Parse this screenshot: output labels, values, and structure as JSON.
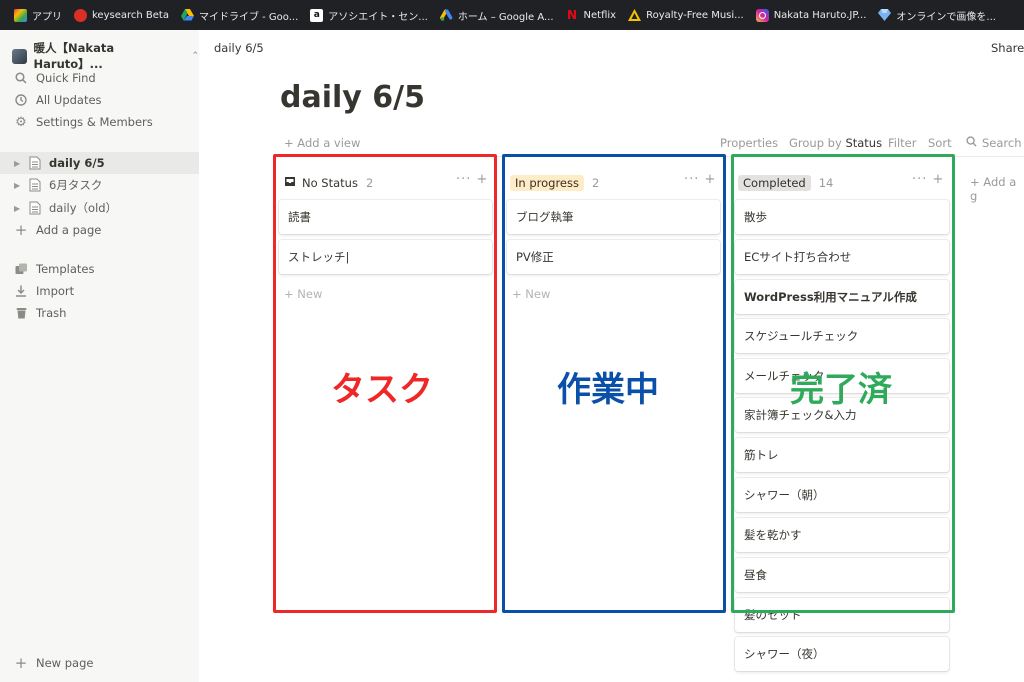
{
  "bookmarks": [
    {
      "label": "アプリ",
      "icon": "apps-grid-icon",
      "color": "#e8453c"
    },
    {
      "label": "keysearch Beta",
      "icon": "keysearch-icon",
      "color": "#d93025"
    },
    {
      "label": "マイドライブ - Goo...",
      "icon": "google-drive-icon",
      "color": "#1fa463"
    },
    {
      "label": "アソシエイト・セン...",
      "icon": "amazon-icon",
      "color": "#ffffff"
    },
    {
      "label": "ホーム – Google A...",
      "icon": "google-ads-icon",
      "color": "#fbbc04"
    },
    {
      "label": "Netflix",
      "icon": "netflix-icon",
      "color": "#e50914"
    },
    {
      "label": "Royalty-Free Musi...",
      "icon": "royalty-free-music-icon",
      "color": "#f5c400"
    },
    {
      "label": "Nakata Haruto.JP...",
      "icon": "instagram-icon",
      "color": "#d6249f"
    },
    {
      "label": "オンラインで画像を...",
      "icon": "gem-icon",
      "color": "#7ab3f0"
    }
  ],
  "sidebar": {
    "workspace": "暖人【Nakata Haruto】...",
    "quick_find": "Quick Find",
    "all_updates": "All Updates",
    "settings": "Settings & Members",
    "pages": [
      {
        "label": "daily 6/5",
        "active": true
      },
      {
        "label": "6月タスク",
        "active": false
      },
      {
        "label": "daily（old）",
        "active": false
      }
    ],
    "add_page": "Add a page",
    "templates": "Templates",
    "import": "Import",
    "trash": "Trash",
    "new_page": "New page"
  },
  "topbar": {
    "breadcrumb": "daily 6/5",
    "share": "Share"
  },
  "page": {
    "title": "daily 6/5"
  },
  "toolbar": {
    "add_view": "+ Add a view",
    "properties": "Properties",
    "group_by": "Group by",
    "group_value": "Status",
    "filter": "Filter",
    "sort": "Sort",
    "search": "Search"
  },
  "board": {
    "columns": [
      {
        "name": "No Status",
        "count": "2",
        "cards": [
          "読書",
          "ストレッチ|"
        ],
        "new_label": "+ New",
        "pill_color": "transparent"
      },
      {
        "name": "In progress",
        "count": "2",
        "cards": [
          "ブログ執筆",
          "PV修正"
        ],
        "new_label": "+ New",
        "pill_color": "#fdecc8"
      },
      {
        "name": "Completed",
        "count": "14",
        "cards": [
          "散歩",
          "ECサイト打ち合わせ",
          "WordPress利用マニュアル作成",
          "スケジュールチェック",
          "メールチェック",
          "家計簿チェック&入力",
          "筋トレ",
          "シャワー（朝）",
          "髪を乾かす",
          "昼食",
          "髪のセット",
          "シャワー（夜）"
        ],
        "pill_color": "#e3e2e0"
      }
    ],
    "add_group": "+ Add a g"
  },
  "annotations": [
    {
      "label": "タスク",
      "color": "#ef2727"
    },
    {
      "label": "作業中",
      "color": "#0a4fa8"
    },
    {
      "label": "完了済",
      "color": "#2eaa5a"
    }
  ]
}
